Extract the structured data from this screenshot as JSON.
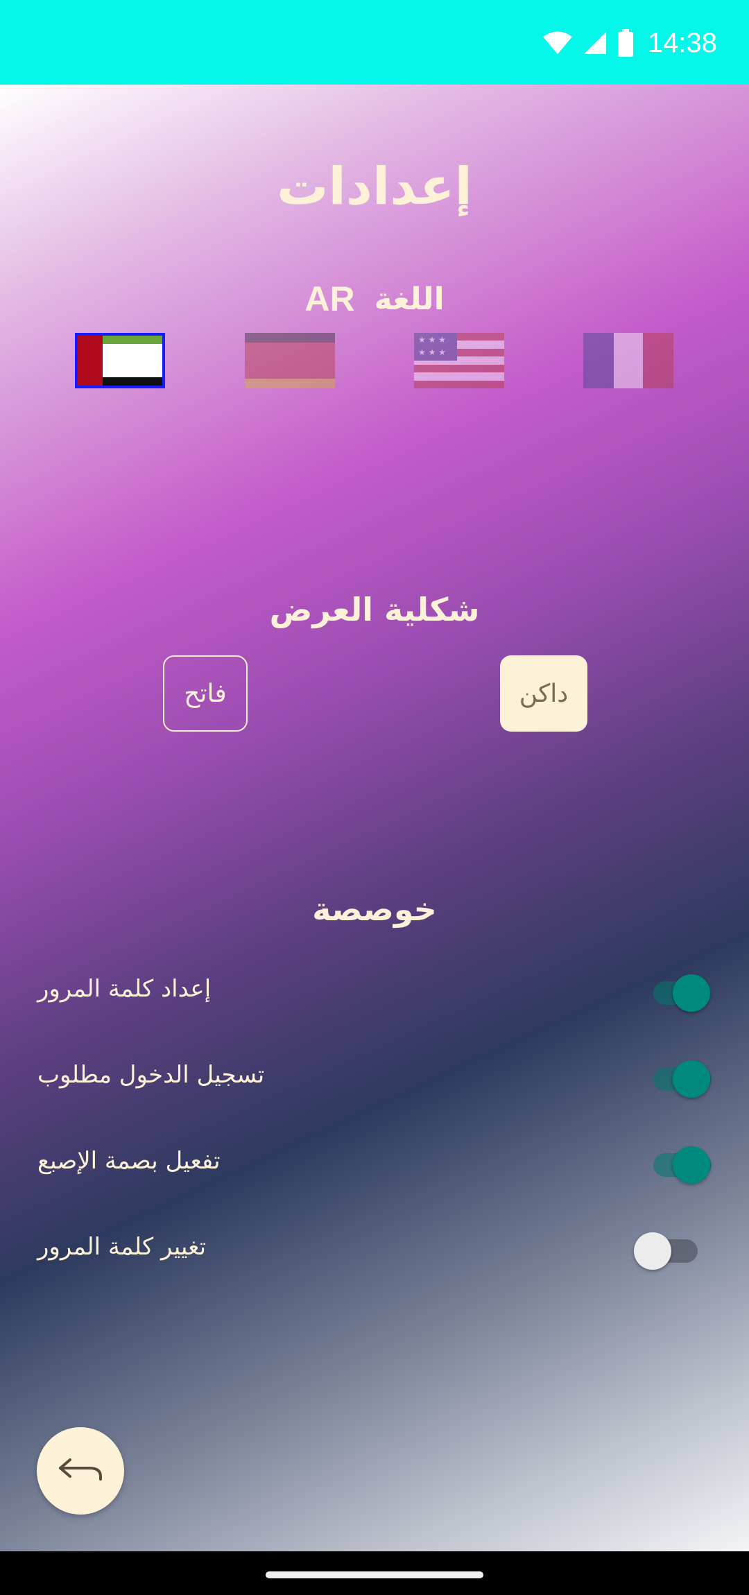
{
  "status_bar": {
    "time": "14:38",
    "icons": [
      "wifi-icon",
      "cellular-signal-icon",
      "battery-icon"
    ],
    "background_color": "#05f7ea"
  },
  "header": {
    "title": "إعدادات"
  },
  "language": {
    "label": "اللغة",
    "current_code": "AR",
    "flags": [
      {
        "name": "uae-flag",
        "selected": true
      },
      {
        "name": "germany-flag",
        "selected": false
      },
      {
        "name": "usa-flag",
        "selected": false
      },
      {
        "name": "france-flag",
        "selected": false
      }
    ]
  },
  "display_mode": {
    "title": "شكلية العرض",
    "light_label": "فاتح",
    "dark_label": "داكن",
    "selected": "dark"
  },
  "privacy": {
    "title": "خوصصة",
    "settings": [
      {
        "label": "إعداد كلمة المرور",
        "enabled": true
      },
      {
        "label": "تسجيل الدخول مطلوب",
        "enabled": true
      },
      {
        "label": "تفعيل بصمة الإصبع",
        "enabled": true
      },
      {
        "label": "تغيير كلمة المرور",
        "enabled": false
      }
    ]
  },
  "back_button": {
    "icon": "back-arrow-icon"
  },
  "colors": {
    "accent_cream": "#fdf1d8",
    "switch_on": "#008a7d",
    "flag_selection_border": "#1a1aff"
  }
}
